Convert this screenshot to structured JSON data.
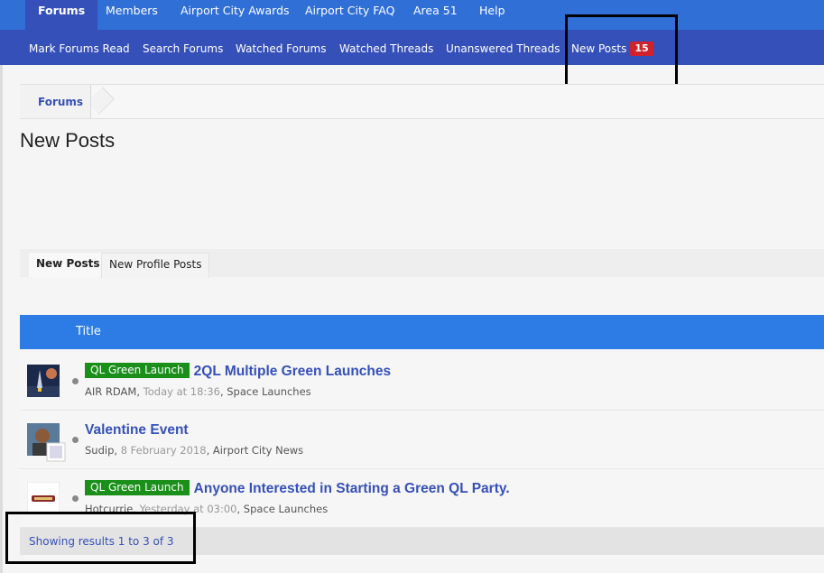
{
  "topnav": {
    "tabs": [
      "Forums",
      "Members",
      "Airport City Awards",
      "Airport City FAQ",
      "Area 51",
      "Help"
    ]
  },
  "subnav": {
    "links": [
      "Mark Forums Read",
      "Search Forums",
      "Watched Forums",
      "Watched Threads",
      "Unanswered Threads",
      "New Posts"
    ],
    "new_posts_badge": "15"
  },
  "breadcrumb": {
    "items": [
      "Forums"
    ]
  },
  "page": {
    "title": "New Posts"
  },
  "tabs": [
    "New Posts",
    "New Profile Posts"
  ],
  "table": {
    "header_title": "Title",
    "rows": [
      {
        "prefix": "QL Green Launch",
        "title": "2QL Multiple Green Launches",
        "author": "AIR RDAM",
        "date": "Today at 18:36",
        "forum": "Space Launches"
      },
      {
        "prefix": "",
        "title": "Valentine Event",
        "author": "Sudip",
        "date": "8 February 2018",
        "forum": "Airport City News"
      },
      {
        "prefix": "QL Green Launch",
        "title": "Anyone Interested in Starting a Green QL Party.",
        "author": "Hotcurrie",
        "date": "Yesterday at 03:00",
        "forum": "Space Launches"
      }
    ]
  },
  "footer": {
    "results_text": "Showing results 1 to 3 of 3"
  },
  "colors": {
    "top_nav": "#2f6fd6",
    "sub_nav": "#3550b8",
    "table_header": "#2d7ce6",
    "prefix_green": "#1a8f1a",
    "badge_red": "#d0222d",
    "link_blue": "#3550b8"
  },
  "icons": [
    "avatar-rocket",
    "avatar-person",
    "avatar-logo"
  ]
}
